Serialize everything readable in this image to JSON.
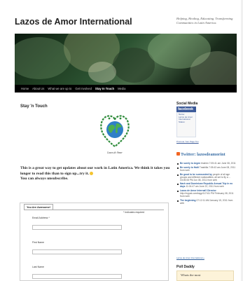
{
  "header": {
    "site_title": "Lazos de Amor International",
    "tagline": "Helping, Healing, Educating. Transforming Communities in Latin America."
  },
  "nav": {
    "items": [
      "Home",
      "About Us",
      "What we are up to",
      "Get Involved",
      "Stay In Touch",
      "Media"
    ],
    "active_index": 4
  },
  "main": {
    "page_title": "Stay 'n Touch",
    "logo_caption": "Lazos de Amor",
    "intro_text": "This is a great way to get updates about our work in Latin America. We think it takes you longer to read this than to sign up...try it.",
    "unsubscribe_text": "You can always unsubscribe."
  },
  "form": {
    "tab_label": "You Are Awesome!",
    "required_note": "* Indicates required",
    "fields": [
      "Email Address *",
      "First Name",
      "Last Name"
    ]
  },
  "sidebar": {
    "social_heading": "Social Media",
    "facebook_badge": "facebook",
    "facebook_box_lines": [
      "Name:",
      "Lazos de Amor International",
      "Status:"
    ],
    "promote_link": "Promote Your Page Too",
    "twitter_heading": "Twitter: lazosdeamorint",
    "tweets": [
      {
        "title": "Be surely to Argen",
        "meta": "tinahim 7:05:41 am June 08, 2011"
      },
      {
        "title": "Be surely to Haiti",
        "meta": "Trasbilla 7:05:43 am June 08, 2011 from web"
      },
      {
        "title": "Be good to be surrounded by",
        "meta": "people of all age groups and different nationalities, all set to fly a ... 03:05:08 PM Jun 08, 2011 from web"
      },
      {
        "title": "Nach and Dominican Republic Annual Trip in no days",
        "meta": "11:04:47 am June 22, 2011 from web"
      },
      {
        "title": "Lazos de Amor Internat'l Director",
        "meta": "http://mypat.com/tagp/117411 PM February 08, 2011 from web"
      },
      {
        "title": "The beginning",
        "meta": "07:12:11 AM January 15, 2011 from web"
      }
    ],
    "twitter_link": "Lazos de Amor International »",
    "poll_heading": "Poll Daddy",
    "poll_question": "Whats the most"
  },
  "colors": {
    "nav_bg": "#000000",
    "facebook_blue": "#3b5998",
    "twitter_blue": "#3a6ea5",
    "poll_bg": "#fdf3d9"
  }
}
